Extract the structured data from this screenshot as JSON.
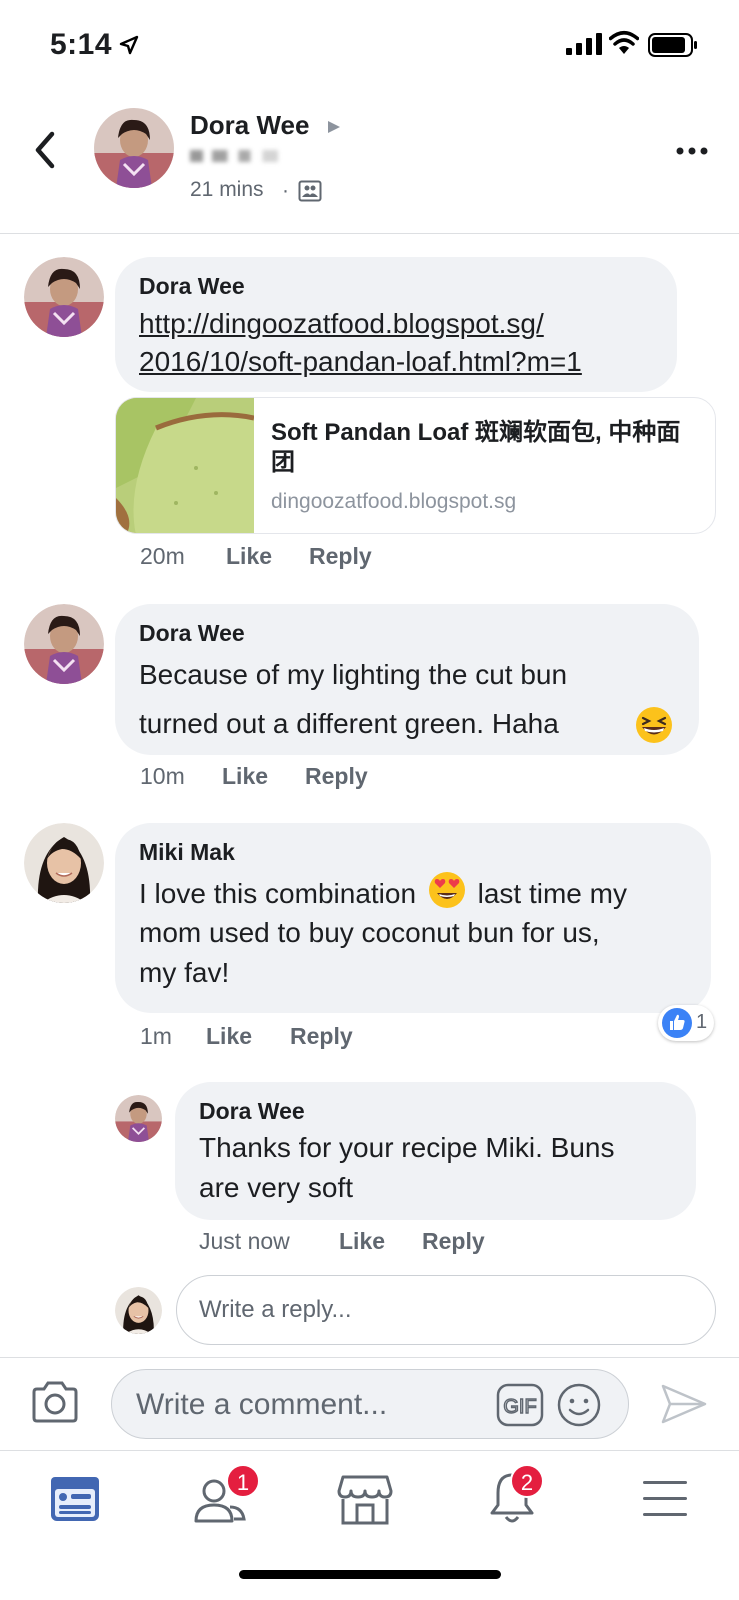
{
  "status_bar": {
    "time": "5:14"
  },
  "post_header": {
    "author": "Dora Wee",
    "time": "21 mins",
    "separator": "·"
  },
  "comments": [
    {
      "author": "Dora Wee",
      "link_lines": [
        "http://dingoozatfood.blogspot.sg/",
        "2016/10/soft-pandan-loaf.html?m=1"
      ],
      "preview": {
        "title": "Soft Pandan Loaf 斑斓软面包, 中种面团",
        "domain": "dingoozatfood.blogspot.sg"
      },
      "time": "20m",
      "like_label": "Like",
      "reply_label": "Reply"
    },
    {
      "author": "Dora Wee",
      "lines": [
        "Because of my lighting the cut bun",
        "turned out a different green. Haha"
      ],
      "time": "10m",
      "like_label": "Like",
      "reply_label": "Reply"
    },
    {
      "author": "Miki Mak",
      "lines": [
        "I love this combination",
        "last time my",
        "mom used to buy coconut bun for us,",
        "my fav!"
      ],
      "time": "1m",
      "like_label": "Like",
      "reply_label": "Reply",
      "reaction_count": "1"
    }
  ],
  "reply": {
    "author": "Dora Wee",
    "lines": [
      "Thanks for your recipe Miki. Buns",
      "are very soft"
    ],
    "time": "Just now",
    "like_label": "Like",
    "reply_label": "Reply"
  },
  "reply_input": {
    "placeholder": "Write a reply..."
  },
  "composer": {
    "placeholder": "Write a comment...",
    "gif_label": "GIF"
  },
  "tabbar": {
    "friends_badge": "1",
    "notifications_badge": "2",
    "active_color": "#4267b2"
  }
}
